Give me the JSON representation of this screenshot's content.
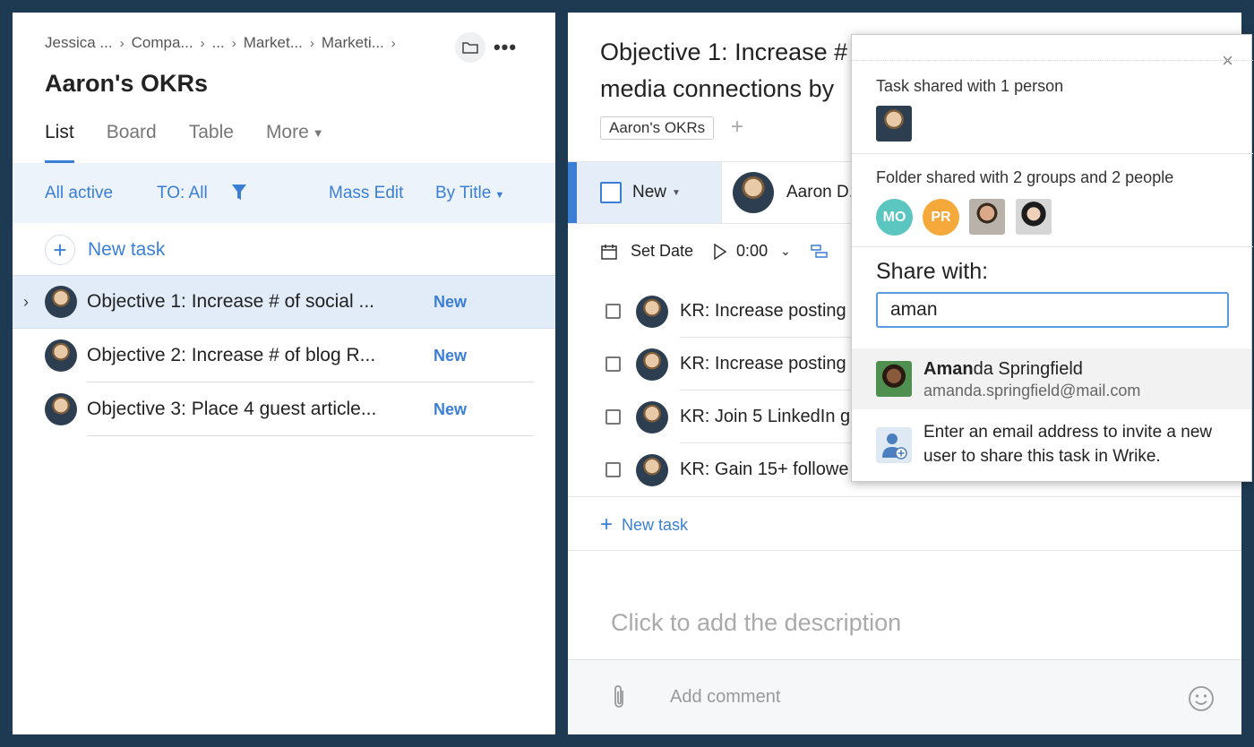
{
  "left": {
    "breadcrumbs": [
      "Jessica ...",
      "Compa...",
      "...",
      "Market...",
      "Marketi..."
    ],
    "title": "Aaron's OKRs",
    "tabs": [
      {
        "label": "List",
        "active": true
      },
      {
        "label": "Board",
        "active": false
      },
      {
        "label": "Table",
        "active": false
      },
      {
        "label": "More",
        "active": false
      }
    ],
    "filters": {
      "status": "All active",
      "to": "TO: All",
      "mass_edit": "Mass Edit",
      "sort": "By Title"
    },
    "new_task": "New task",
    "tasks": [
      {
        "title": "Objective 1: Increase # of social ...",
        "status": "New",
        "selected": true
      },
      {
        "title": "Objective 2: Increase # of blog R...",
        "status": "New",
        "selected": false
      },
      {
        "title": "Objective 3: Place 4 guest article...",
        "status": "New",
        "selected": false
      }
    ]
  },
  "right": {
    "task_title_line1": "Objective 1: Increase #",
    "task_title_line2": "media connections by",
    "folder_chip": "Aaron's OKRs",
    "add_chip": "+",
    "status": "New",
    "assignee": "Aaron D.",
    "set_date": "Set Date",
    "timer": "0:00",
    "key_results": [
      "KR: Increase posting",
      "KR: Increase posting",
      "KR: Join 5 LinkedIn g",
      "KR: Gain 15+ followe"
    ],
    "new_task": "New task",
    "description_placeholder": "Click to add the description",
    "comment_placeholder": "Add comment"
  },
  "popover": {
    "close": "×",
    "task_shared": "Task shared with 1 person",
    "folder_shared": "Folder shared with 2 groups and 2 people",
    "groups": [
      {
        "initials": "MO",
        "color": "#5bc5c0"
      },
      {
        "initials": "PR",
        "color": "#f5a93a"
      }
    ],
    "share_with_label": "Share with:",
    "share_input_value": "aman",
    "suggestion": {
      "name_match": "Aman",
      "name_rest": "da Springfield",
      "email": "amanda.springfield@mail.com"
    },
    "invite_text": "Enter an email address to invite a new user to share this task in Wrike."
  },
  "colors": {
    "accent": "#3a7fd5",
    "background": "#1e3a52"
  }
}
